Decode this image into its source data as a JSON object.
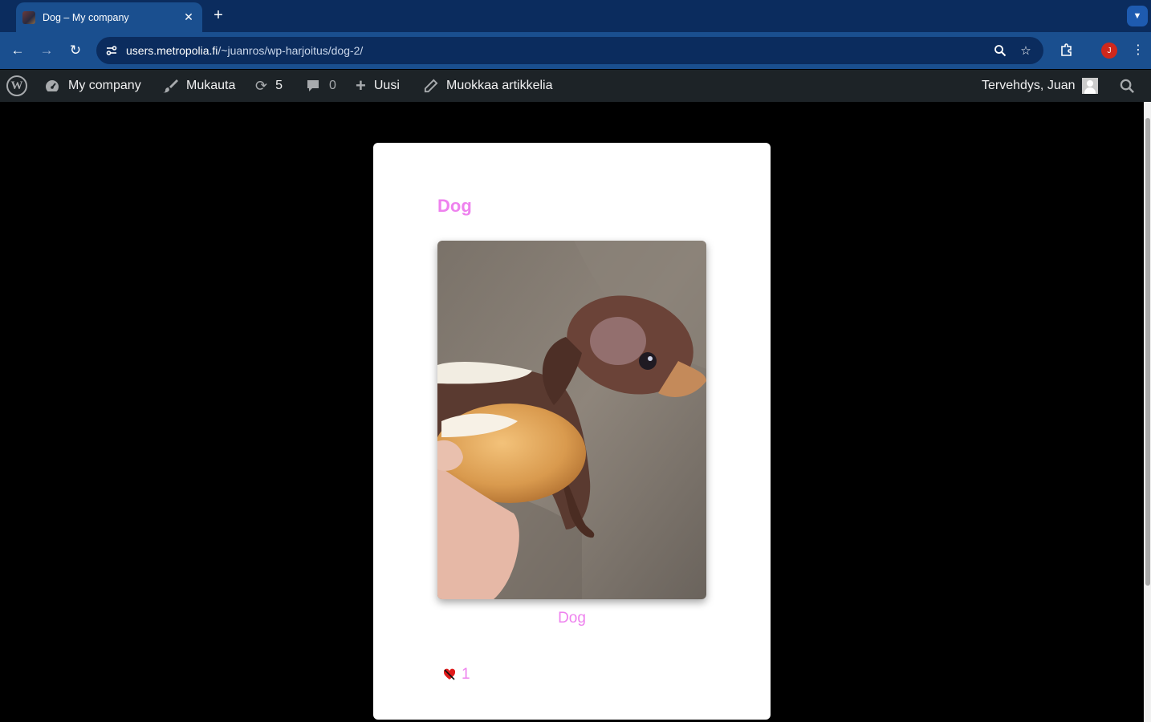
{
  "browser": {
    "tab_title": "Dog – My company",
    "url_host": "users.metropolia.fi",
    "url_path": "/~juanros/wp-harjoitus/dog-2/",
    "profile_initial": "J"
  },
  "adminbar": {
    "site_name": "My company",
    "customize": "Mukauta",
    "updates_count": "5",
    "comments_count": "0",
    "new_label": "Uusi",
    "edit_label": "Muokkaa artikkelia",
    "greeting": "Tervehdys, Juan"
  },
  "post": {
    "title": "Dog",
    "image_caption": "Dog",
    "likes_count": "1"
  },
  "colors": {
    "accent_pink": "#ee82ee",
    "adminbar_bg": "#1d2327",
    "chrome_bg": "#1a4f8f"
  }
}
